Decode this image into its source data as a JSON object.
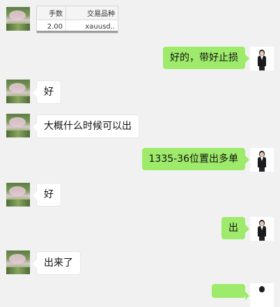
{
  "trade_table": {
    "headers": [
      "手数",
      "交易品种"
    ],
    "row": [
      "2.00",
      "xauusd.."
    ]
  },
  "messages": [
    {
      "side": "in",
      "kind": "image",
      "text": ""
    },
    {
      "side": "out",
      "text": "好的，带好止损"
    },
    {
      "side": "in",
      "text": "好"
    },
    {
      "side": "in",
      "text": "大概什么时候可以出"
    },
    {
      "side": "out",
      "text": "1335-36位置出多单"
    },
    {
      "side": "in",
      "text": "好"
    },
    {
      "side": "out",
      "text": "出"
    },
    {
      "side": "in",
      "text": "出来了"
    }
  ],
  "colors": {
    "background": "#f1f1f1",
    "outgoing_bubble": "#9eea6a",
    "incoming_bubble": "#ffffff"
  },
  "icons": {
    "contact_avatar": "cherry-blossom-park-avatar",
    "self_avatar": "businesswoman-avatar"
  }
}
